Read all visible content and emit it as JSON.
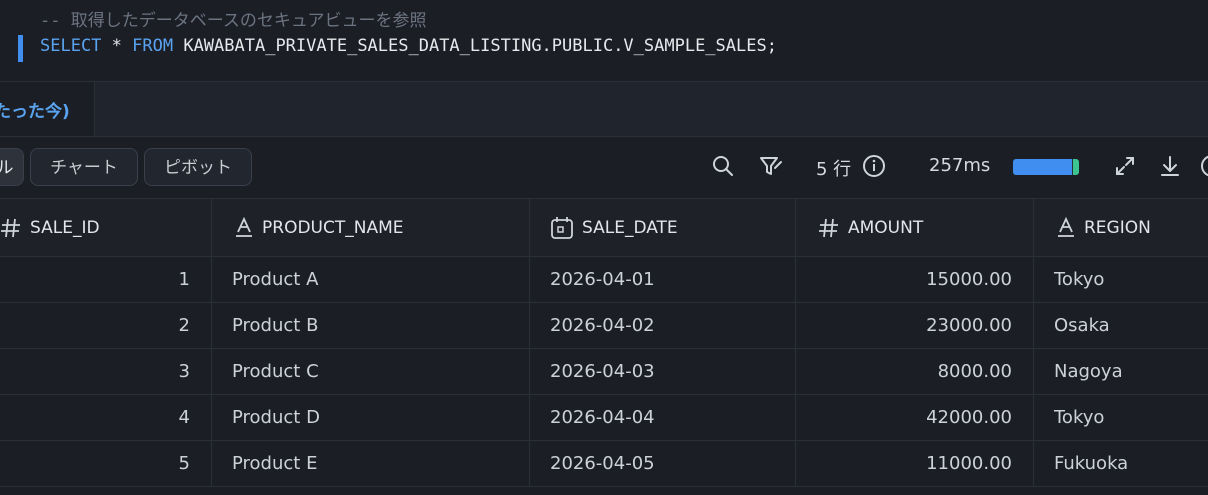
{
  "editor": {
    "comment": "-- 取得したデータベースのセキュアビューを参照",
    "sql_select": "SELECT",
    "sql_star": " * ",
    "sql_from": "FROM",
    "sql_object": " KAWABATA_PRIVATE_SALES_DATA_LISTING.PUBLIC.V_SAMPLE_SALES;"
  },
  "tabs": {
    "active_label": "たった今)"
  },
  "toolbar": {
    "table_label": "ル",
    "chart_label": "チャート",
    "pivot_label": "ピボット",
    "rows_count": "5 行",
    "elapsed": "257ms",
    "progress": 0.9,
    "icons": [
      "search-icon",
      "filter-icon",
      "info-icon",
      "expand-icon",
      "download-icon"
    ]
  },
  "table": {
    "columns": [
      {
        "label": "SALE_ID",
        "icon": "number-icon"
      },
      {
        "label": "PRODUCT_NAME",
        "icon": "text-icon"
      },
      {
        "label": "SALE_DATE",
        "icon": "calendar-icon"
      },
      {
        "label": "AMOUNT",
        "icon": "number-icon"
      },
      {
        "label": "REGION",
        "icon": "text-icon"
      }
    ],
    "rows": [
      [
        "1",
        "Product A",
        "2026-04-01",
        "15000.00",
        "Tokyo"
      ],
      [
        "2",
        "Product B",
        "2026-04-02",
        "23000.00",
        "Osaka"
      ],
      [
        "3",
        "Product C",
        "2026-04-03",
        "8000.00",
        "Nagoya"
      ],
      [
        "4",
        "Product D",
        "2026-04-04",
        "42000.00",
        "Tokyo"
      ],
      [
        "5",
        "Product E",
        "2026-04-05",
        "11000.00",
        "Fukuoka"
      ]
    ]
  },
  "colors": {
    "accent": "#3f8ef0",
    "keyword": "#5aa3f0",
    "success": "#3bc48f",
    "background": "#1b1e25"
  }
}
